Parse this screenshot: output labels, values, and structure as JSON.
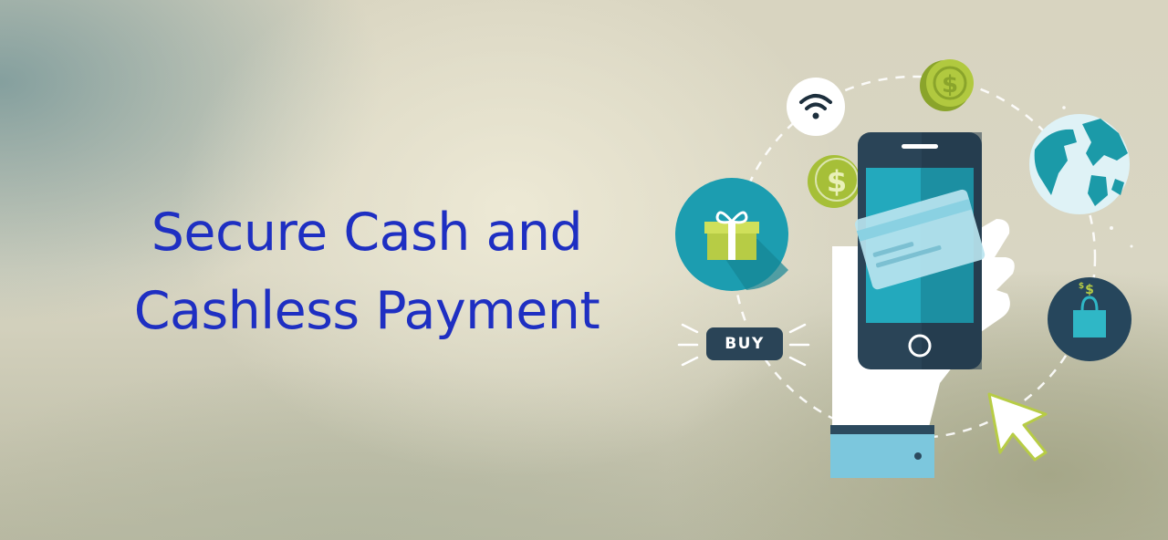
{
  "headline": {
    "line1": "Secure Cash and",
    "line2": "Cashless Payment"
  },
  "buy_button": {
    "label": "BUY"
  },
  "icons": {
    "wifi": "wifi-icon",
    "coin": "dollar-coin-icon",
    "globe": "globe-icon",
    "gift": "gift-icon",
    "bag": "shopping-bag-icon",
    "card": "credit-card-icon",
    "cursor": "cursor-icon"
  },
  "colors": {
    "headline": "#1e2fc2",
    "teal": "#1fa3b4",
    "navy": "#2e4a5e",
    "coin": "#a9c23a"
  }
}
